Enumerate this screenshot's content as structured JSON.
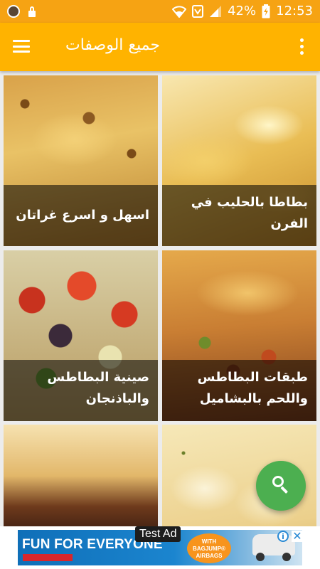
{
  "status_bar": {
    "battery_percent": "42%",
    "time": "12:53",
    "icons": [
      "app-badge-icon",
      "lock-icon",
      "wifi-icon",
      "data-saver-icon",
      "signal-icon",
      "battery-charging-icon"
    ]
  },
  "app_bar": {
    "title": "جميع الوصفات",
    "menu_icon": "hamburger-menu-icon",
    "overflow_icon": "more-vert-icon",
    "color": "#ffb300"
  },
  "recipes": [
    {
      "title": "بطاطا بالحليب في الفرن"
    },
    {
      "title": "اسهل و اسرع غراتان"
    },
    {
      "title": "طبقات البطاطس واللحم بالبشاميل"
    },
    {
      "title": "صينية البطاطس والباذنجان"
    },
    {
      "title": ""
    },
    {
      "title": ""
    }
  ],
  "fab": {
    "icon": "search-icon",
    "color": "#4caf50"
  },
  "ad": {
    "label": "Test Ad",
    "headline": "FUN FOR EVERYONE",
    "bubble_text": "WITH BAGJUMP® AIRBAGS",
    "info_icon": "ad-choices-icon",
    "close_icon": "close-icon"
  }
}
